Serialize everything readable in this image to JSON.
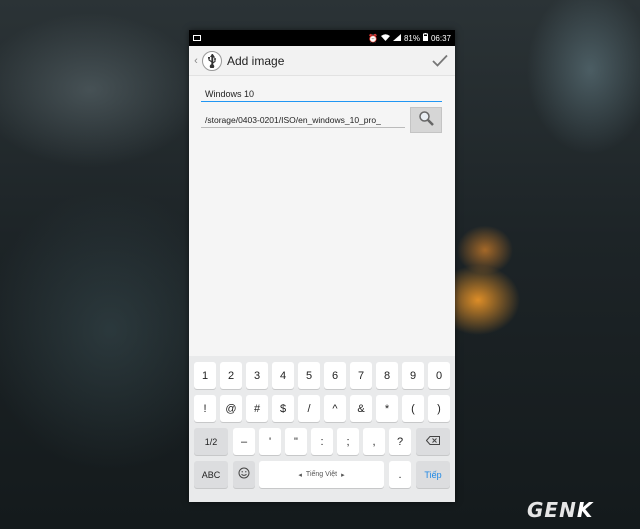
{
  "status_bar": {
    "battery": "81%",
    "time": "06:37"
  },
  "app_bar": {
    "title": "Add image"
  },
  "form": {
    "name_value": "Windows 10",
    "path_value": "/storage/0403-0201/ISO/en_windows_10_pro_"
  },
  "keyboard": {
    "row1": [
      "1",
      "2",
      "3",
      "4",
      "5",
      "6",
      "7",
      "8",
      "9",
      "0"
    ],
    "row2": [
      "!",
      "@",
      "#",
      "$",
      "/",
      "^",
      "&",
      "*",
      "(",
      ")"
    ],
    "row3": [
      "1/2",
      "–",
      "'",
      "\"",
      ":",
      ";",
      ",",
      "?"
    ],
    "row4": {
      "abc": "ABC",
      "space_label": "Tiếng Việt",
      "period": ".",
      "enter_label": "Tiếp"
    }
  },
  "watermark": {
    "text_a": "GEN",
    "text_b": "K"
  }
}
